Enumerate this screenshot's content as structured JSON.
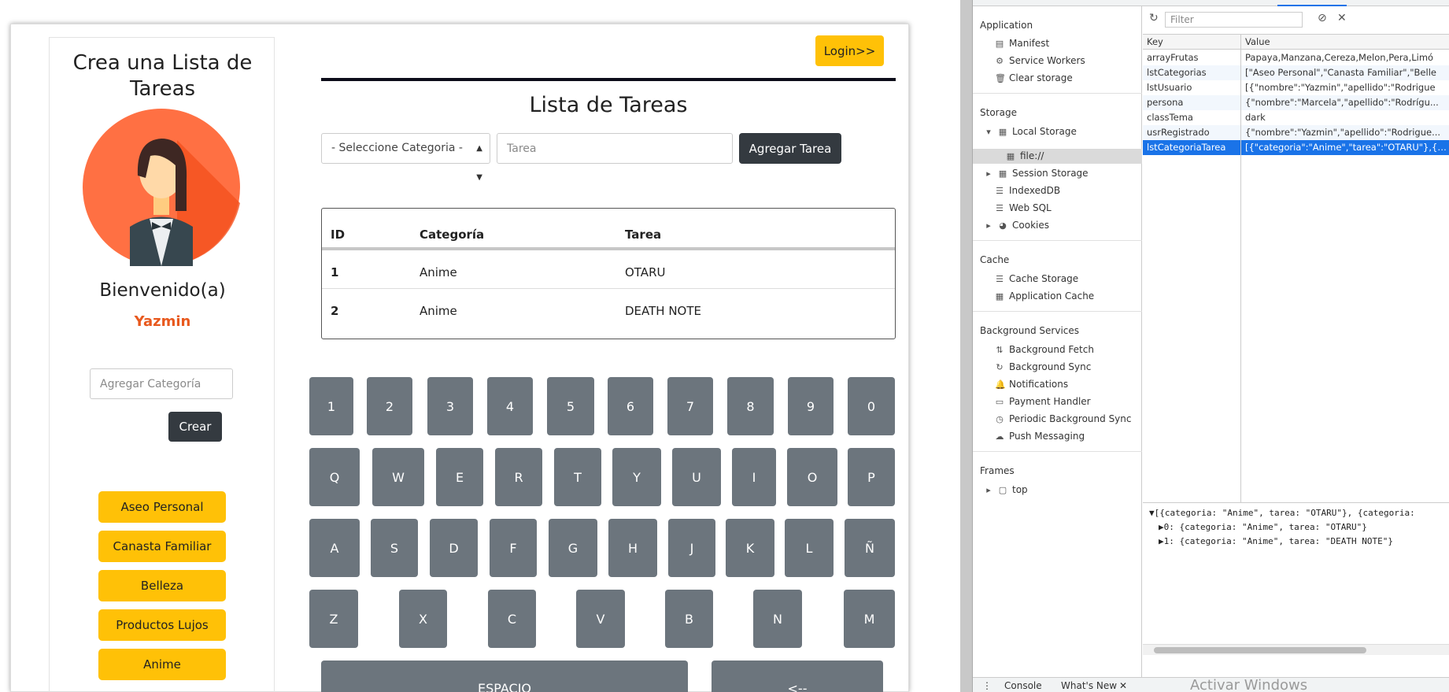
{
  "sidebar": {
    "title": "Crea una Lista de Tareas",
    "welcome": "Bienvenido(a)",
    "username": "Yazmin",
    "category_placeholder": "Agregar Categoría",
    "create_label": "Crear",
    "categories": [
      "Aseo Personal",
      "Canasta Familiar",
      "Belleza",
      "Productos Lujos",
      "Anime"
    ]
  },
  "header": {
    "login_label": "Login>>"
  },
  "main": {
    "title": "Lista de Tareas",
    "select_label": "- Seleccione Categoria -",
    "task_placeholder": "Tarea",
    "add_label": "Agregar Tarea",
    "table": {
      "headers": [
        "ID",
        "Categoría",
        "Tarea"
      ],
      "rows": [
        [
          "1",
          "Anime",
          "OTARU"
        ],
        [
          "2",
          "Anime",
          "DEATH NOTE"
        ]
      ]
    }
  },
  "keyboard": {
    "row1": [
      "1",
      "2",
      "3",
      "4",
      "5",
      "6",
      "7",
      "8",
      "9",
      "0"
    ],
    "row2": [
      "Q",
      "W",
      "E",
      "R",
      "T",
      "Y",
      "U",
      "I",
      "O",
      "P"
    ],
    "row3": [
      "A",
      "S",
      "D",
      "F",
      "G",
      "H",
      "J",
      "K",
      "L",
      "Ñ"
    ],
    "row4": [
      "Z",
      "X",
      "C",
      "V",
      "B",
      "N",
      "M"
    ],
    "space_label": "ESPACIO",
    "backspace_label": "<--"
  },
  "devtools": {
    "sidebar": {
      "application_title": "Application",
      "application_items": [
        "Manifest",
        "Service Workers",
        "Clear storage"
      ],
      "storage_title": "Storage",
      "local_storage": "Local Storage",
      "local_storage_origin": "file://",
      "storage_items": [
        "Session Storage",
        "IndexedDB",
        "Web SQL",
        "Cookies"
      ],
      "cache_title": "Cache",
      "cache_items": [
        "Cache Storage",
        "Application Cache"
      ],
      "bg_title": "Background Services",
      "bg_items": [
        "Background Fetch",
        "Background Sync",
        "Notifications",
        "Payment Handler",
        "Periodic Background Sync",
        "Push Messaging"
      ],
      "frames_title": "Frames",
      "frames_item": "top"
    },
    "filter_placeholder": "Filter",
    "kv_headers": [
      "Key",
      "Value"
    ],
    "kv_rows": [
      {
        "key": "arrayFrutas",
        "value": "Papaya,Manzana,Cereza,Melon,Pera,Limó"
      },
      {
        "key": "lstCategorias",
        "value": "[\"Aseo Personal\",\"Canasta Familiar\",\"Belle"
      },
      {
        "key": "lstUsuario",
        "value": "[{\"nombre\":\"Yazmin\",\"apellido\":\"Rodrigue"
      },
      {
        "key": "persona",
        "value": "{\"nombre\":\"Marcela\",\"apellido\":\"Rodrígu..."
      },
      {
        "key": "classTema",
        "value": "dark"
      },
      {
        "key": "usrRegistrado",
        "value": "{\"nombre\":\"Yazmin\",\"apellido\":\"Rodrigue..."
      },
      {
        "key": "lstCategoriaTarea",
        "value": "[{\"categoria\":\"Anime\",\"tarea\":\"OTARU\"},{\"..."
      }
    ],
    "preview": [
      "▼[{categoria: \"Anime\", tarea: \"OTARU\"}, {categoria:",
      "▶0: {categoria: \"Anime\", tarea: \"OTARU\"}",
      "▶1: {categoria: \"Anime\", tarea: \"DEATH NOTE\"}"
    ],
    "drawer_tabs": [
      "Console",
      "What's New"
    ]
  },
  "os": {
    "activate_windows": "Activar Windows"
  },
  "colors": {
    "accent": "#ffc107",
    "dark": "#343a40",
    "key_gray": "#6c757d",
    "username": "#e8591e",
    "devtools_select": "#1a73e8"
  }
}
